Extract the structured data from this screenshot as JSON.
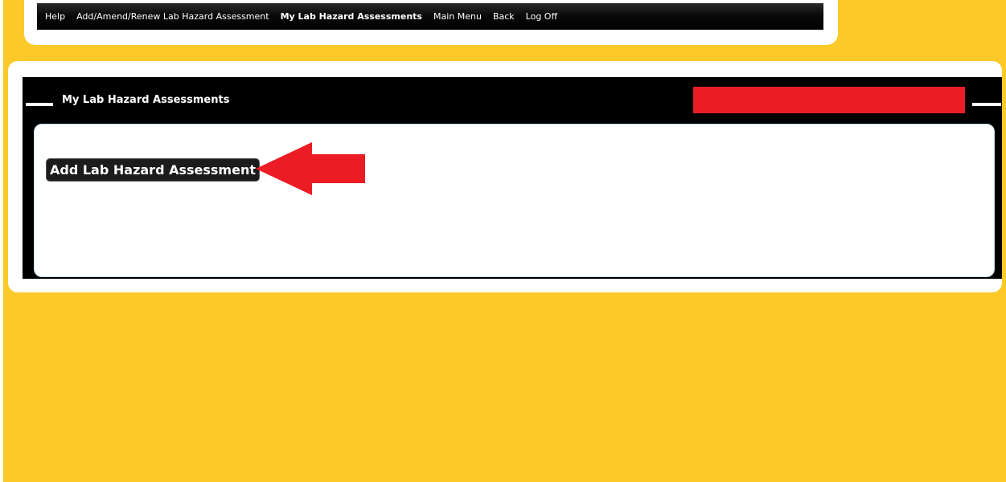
{
  "nav": {
    "items": [
      {
        "label": "Help",
        "active": false
      },
      {
        "label": "Add/Amend/Renew Lab Hazard Assessment",
        "active": false
      },
      {
        "label": "My Lab Hazard Assessments",
        "active": true
      },
      {
        "label": "Main Menu",
        "active": false
      },
      {
        "label": "Back",
        "active": false
      },
      {
        "label": "Log Off",
        "active": false
      }
    ]
  },
  "panel": {
    "title": "My Lab Hazard Assessments",
    "add_button_label": "Add Lab Hazard Assessment"
  },
  "colors": {
    "background": "#fbca28",
    "nav_bar": "#000000",
    "redaction": "#ec1c24",
    "arrow": "#ec1c24"
  },
  "annotations": {
    "arrow_icon": "red-arrow-pointing-left-icon",
    "redaction": "red-redaction-box"
  }
}
